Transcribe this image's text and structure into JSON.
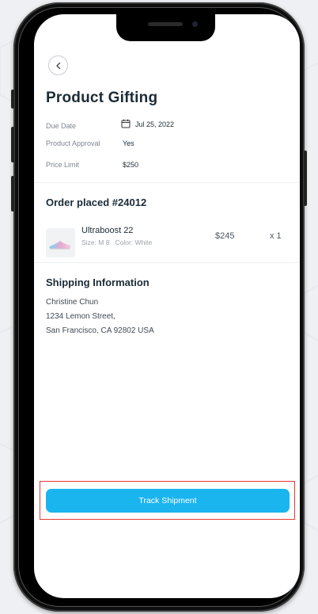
{
  "colors": {
    "accent": "#1ab4ef",
    "highlight": "#e53935",
    "text_dark": "#1c2b36",
    "text_muted": "#7d8691"
  },
  "header": {
    "back_icon": "chevron-left-icon",
    "title": "Product Gifting"
  },
  "details": [
    {
      "label": "Due Date",
      "value": "Jul 25, 2022",
      "icon": "calendar-icon"
    },
    {
      "label": "Product Approval",
      "value": "Yes"
    },
    {
      "label": "Price Limit",
      "value": "$250"
    }
  ],
  "order": {
    "title": "Order placed #24012",
    "item": {
      "name": "Ultraboost 22",
      "meta": "Size: M 8   Color: White",
      "price": "$245",
      "quantity": "x 1",
      "image": "sneaker-image"
    }
  },
  "shipping": {
    "title": "Shipping Information",
    "lines": [
      "Christine Chun",
      "1234 Lemon Street,",
      "San Francisco, CA 92802 USA"
    ]
  },
  "actions": {
    "track_label": "Track Shipment"
  }
}
